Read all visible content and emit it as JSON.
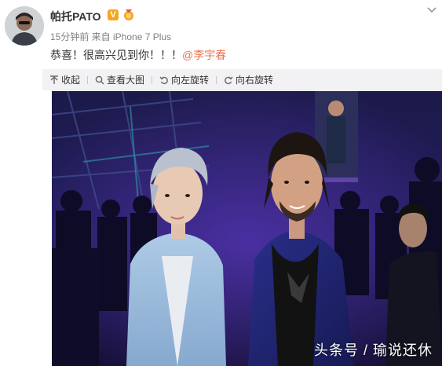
{
  "post": {
    "username": "帕托PATO",
    "verified_badge": "V",
    "meta": "15分钟前 来自 iPhone 7 Plus",
    "text_prefix": "恭喜！很高兴见到你！！！",
    "mention": "@李宇春"
  },
  "toolbar": {
    "collapse": "收起",
    "view_large": "查看大图",
    "rotate_left": "向左旋转",
    "rotate_right": "向右旋转"
  },
  "photo": {
    "watermark": "头条号 / 瑜说还休"
  },
  "colors": {
    "mention": "#eb7350",
    "verified": "#f5a623",
    "toolbar_bg": "#f2f2f5"
  },
  "icons": [
    "avatar",
    "verified-badge",
    "medal-icon",
    "chevron-down-icon",
    "collapse-icon",
    "search-icon",
    "rotate-left-icon",
    "rotate-right-icon"
  ]
}
